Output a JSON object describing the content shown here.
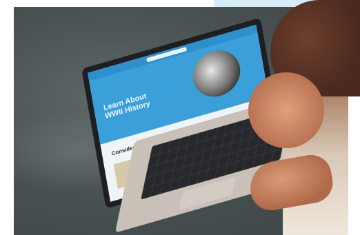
{
  "image": {
    "kind": "photo",
    "subject": "person-using-laptop"
  },
  "laptop_screen": {
    "nav_logo": "",
    "hero_title": "Learn About WWII History",
    "hero_subtitle": "",
    "section_title": "Consider these History"
  },
  "colors": {
    "hero_blue": "#3b9fd9",
    "background_gray": "#4a5354"
  }
}
